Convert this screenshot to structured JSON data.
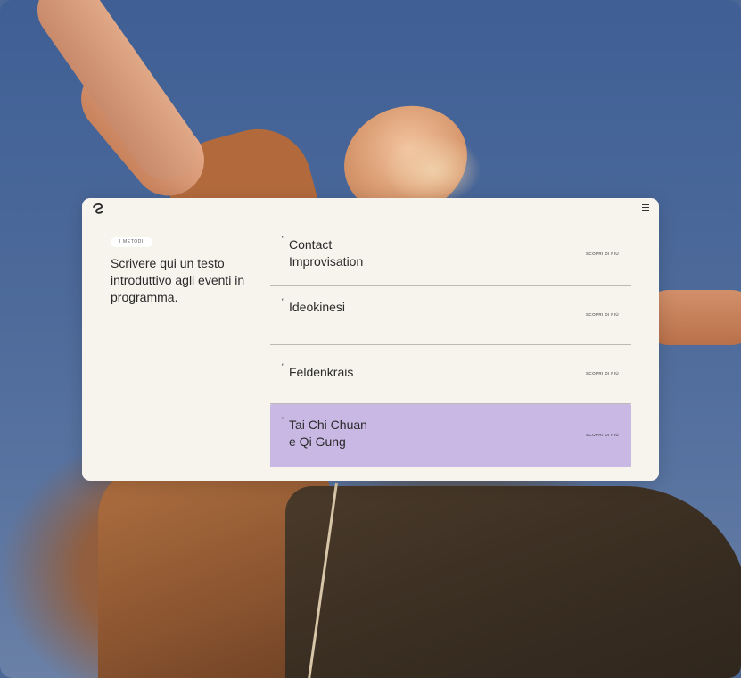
{
  "header": {
    "menu_icon": "hamburger-icon",
    "logo_icon": "brand-logo-icon"
  },
  "intro": {
    "tag": "I METODI",
    "text": "Scrivere qui un testo introduttivo agli eventi in programma."
  },
  "methods": [
    {
      "line1": "Contact",
      "line2": "Improvisation",
      "cta": "SCOPRI DI PIÙ",
      "active": false
    },
    {
      "line1": "Ideokinesi",
      "line2": "",
      "cta": "SCOPRI DI PIÙ",
      "active": false
    },
    {
      "line1": "Feldenkrais",
      "line2": "",
      "cta": "SCOPRI DI PIÙ",
      "active": false
    },
    {
      "line1": "Tai Chi Chuan",
      "line2": "e Qi Gung",
      "cta": "SCOPRI DI PIÙ",
      "active": true
    }
  ],
  "colors": {
    "card_bg": "#f7f4ee",
    "active_bg": "#c9b8e4",
    "divider": "#bdbab4"
  }
}
